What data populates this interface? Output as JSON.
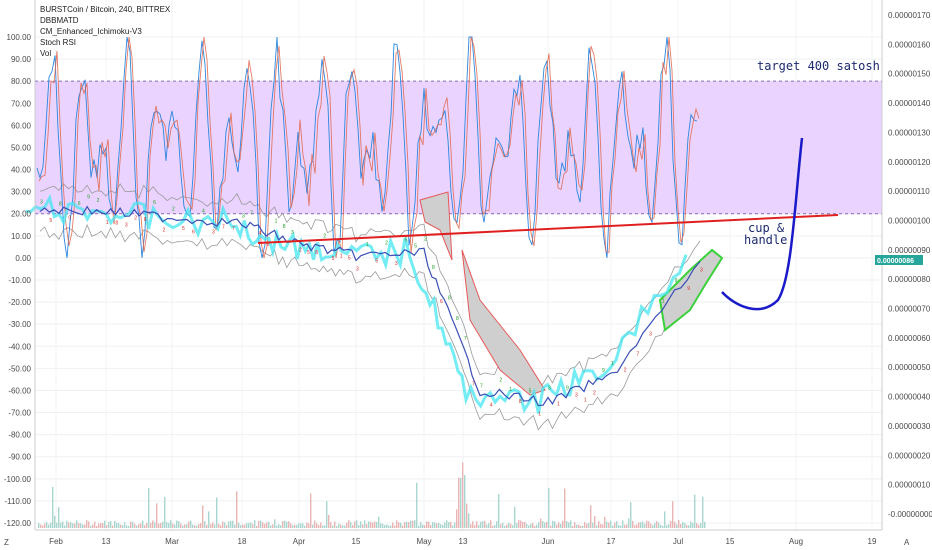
{
  "header": {
    "title": "BURSTCoin / Bitcoin, 240, BITTREX",
    "indicators": [
      "DBBMATD",
      "CM_Enhanced_Ichimoku-V3",
      "Stoch RSI",
      "Vol"
    ]
  },
  "annotations": {
    "target": "target 400 satosh",
    "pattern_line1": "cup &",
    "pattern_line2": "handle"
  },
  "last_price_tag": "0.00000086",
  "corner_labels": {
    "left": "Z",
    "right": "A"
  },
  "colors": {
    "band_fill": "#e6ccff",
    "stoch_k": "#2e86de",
    "stoch_d": "#e0654a",
    "trendline": "#e02020",
    "drawing": "#1a1ac8",
    "price_tag": "#26a69a",
    "cloud_fill": "#cfcfcf",
    "ichimoku_lead": "#3ad13a",
    "ichimoku_lag": "#e85858",
    "bb": "#9a9a9a"
  },
  "chart_data": {
    "type": "line",
    "left_axis": {
      "ticks": [
        "100.00",
        "90.00",
        "80.00",
        "70.00",
        "60.00",
        "50.00",
        "40.00",
        "30.00",
        "20.00",
        "10.00",
        "0.00",
        "-10.00",
        "-20.00",
        "-30.00",
        "-40.00",
        "-50.00",
        "-60.00",
        "-70.00",
        "-80.00",
        "-90.00",
        "-100.00",
        "-110.00",
        "-120.00"
      ],
      "range": [
        -120,
        100
      ]
    },
    "right_axis": {
      "ticks": [
        "0.00000170",
        "0.00000160",
        "0.00000150",
        "0.00000140",
        "0.00000130",
        "0.00000120",
        "0.00000110",
        "0.00000100",
        "0.00000090",
        "0.00000080",
        "0.00000070",
        "0.00000060",
        "0.00000050",
        "0.00000040",
        "0.00000030",
        "0.00000020",
        "0.00000010",
        "-0.00000000"
      ],
      "range": [
        0,
        1.7e-06
      ]
    },
    "x_axis": {
      "ticks": [
        "Feb",
        "13",
        "Mar",
        "18",
        "Apr",
        "15",
        "May",
        "13",
        "Jun",
        "17",
        "Jul",
        "15",
        "Aug",
        "19"
      ]
    },
    "stoch_rsi_band": [
      20,
      80
    ],
    "price_series": {
      "name": "",
      "x": [
        "Feb",
        "13",
        "Mar",
        "18",
        "Apr",
        "15",
        "May",
        "13",
        "Jun",
        "17",
        "Jul"
      ],
      "values": [
        1.04e-06,
        1.03e-06,
        1.01e-06,
        9.9e-07,
        9.2e-07,
        8.8e-07,
        8.9e-07,
        4.2e-07,
        3.8e-07,
        4.7e-07,
        8.6e-07
      ]
    }
  }
}
